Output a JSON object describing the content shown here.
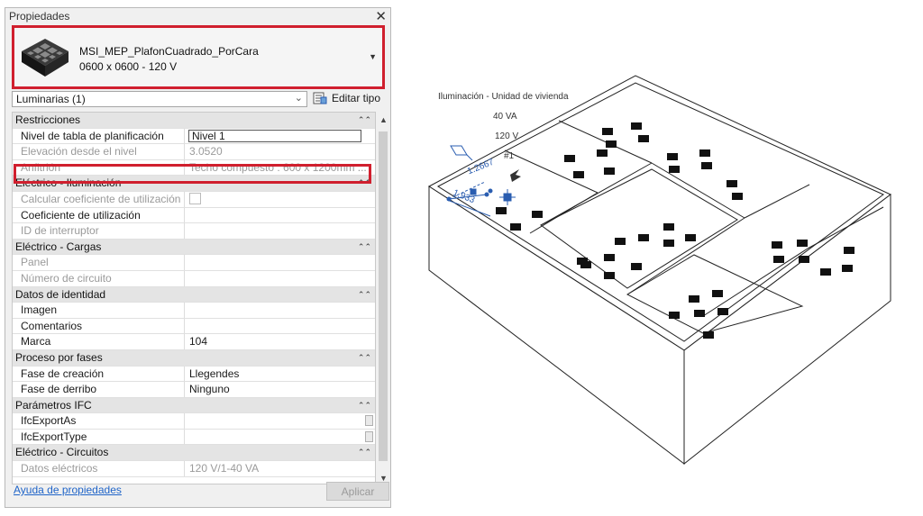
{
  "palette": {
    "title": "Propiedades",
    "type_family": "MSI_MEP_PlafonCuadrado_PorCara",
    "type_name": "0600 x 0600 - 120 V",
    "category_filter": "Luminarias (1)",
    "edit_type_label": "Editar tipo",
    "help_link": "Ayuda de propiedades",
    "apply_label": "Aplicar",
    "colors": {
      "highlight": "#d01f2e",
      "link": "#1f64c8"
    }
  },
  "props": {
    "restricciones": {
      "title": "Restricciones",
      "nivel_label": "Nivel de tabla de planificación",
      "nivel_value": "Nivel 1",
      "elevacion_label": "Elevación desde el nivel",
      "elevacion_value": "3.0520",
      "anfitrion_label": "Anfitrión",
      "anfitrion_value": "Techo compuesto : 600 x 1200mm ..."
    },
    "iluminacion": {
      "title": "Eléctrico - Iluminación",
      "calc_label": "Calcular coeficiente de utilización",
      "coef_label": "Coeficiente de utilización",
      "interruptor_label": "ID de interruptor"
    },
    "cargas": {
      "title": "Eléctrico - Cargas",
      "panel_label": "Panel",
      "circuito_label": "Número de circuito"
    },
    "identidad": {
      "title": "Datos de identidad",
      "imagen_label": "Imagen",
      "comentarios_label": "Comentarios",
      "marca_label": "Marca",
      "marca_value": "104"
    },
    "fases": {
      "title": "Proceso por fases",
      "creacion_label": "Fase de creación",
      "creacion_value": "Llegendes",
      "derribo_label": "Fase de derribo",
      "derribo_value": "Ninguno"
    },
    "ifc": {
      "title": "Parámetros IFC",
      "exportas_label": "IfcExportAs",
      "exporttype_label": "IfcExportType"
    },
    "circuitos": {
      "title": "Eléctrico - Circuitos",
      "datos_label": "Datos eléctricos",
      "datos_value": "120 V/1-40 VA"
    }
  },
  "view3d": {
    "tag_line1": "Iluminación - Unidad de vivienda",
    "tag_line2": "40 VA",
    "tag_line3": "120 V",
    "tag_line4": "#1",
    "dim1": "1.2667",
    "dim2": "1.933",
    "colors": {
      "model_line": "#222222",
      "selection": "#2a5db0"
    }
  }
}
